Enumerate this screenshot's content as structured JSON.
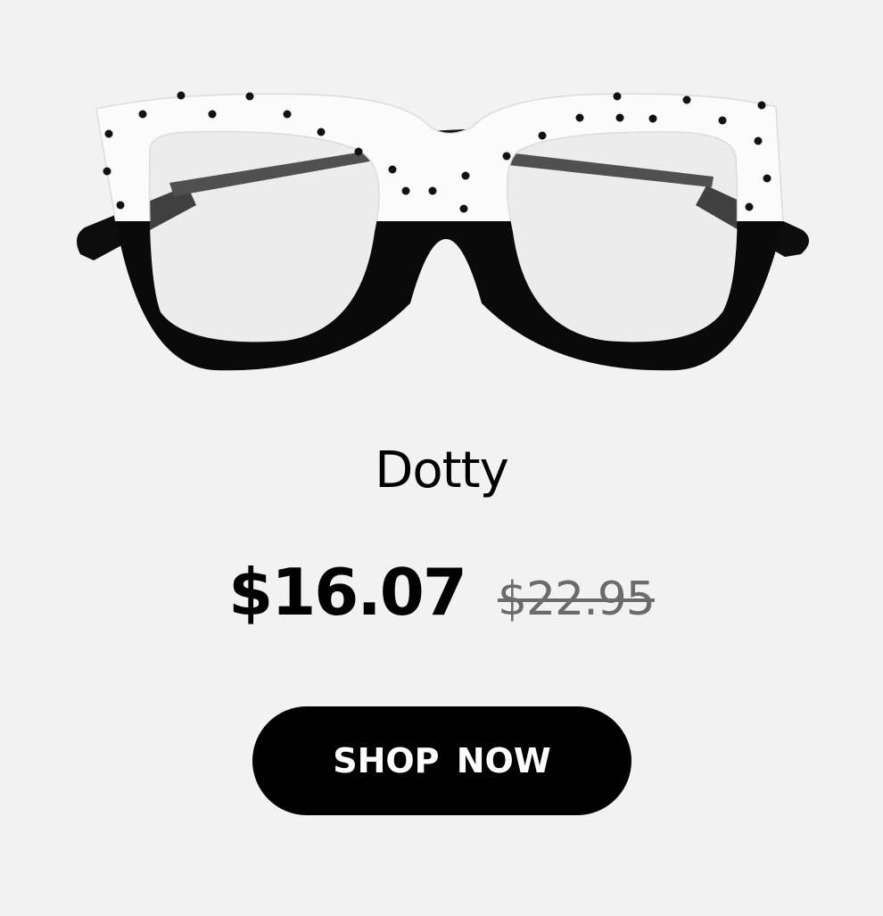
{
  "product": {
    "name": "Dotty",
    "image_alt": "Dotty",
    "price_current": "$16.07",
    "price_original": "$22.95"
  },
  "cta": {
    "label": "SHOP  NOW"
  },
  "colors": {
    "background": "#f2f2f2",
    "button": "#000000",
    "button_text": "#ffffff",
    "price_current": "#000000",
    "price_original": "#6b6b6b"
  },
  "icons": {
    "product_image": "black-and-white-polka-dot-eyeglasses-frame"
  }
}
